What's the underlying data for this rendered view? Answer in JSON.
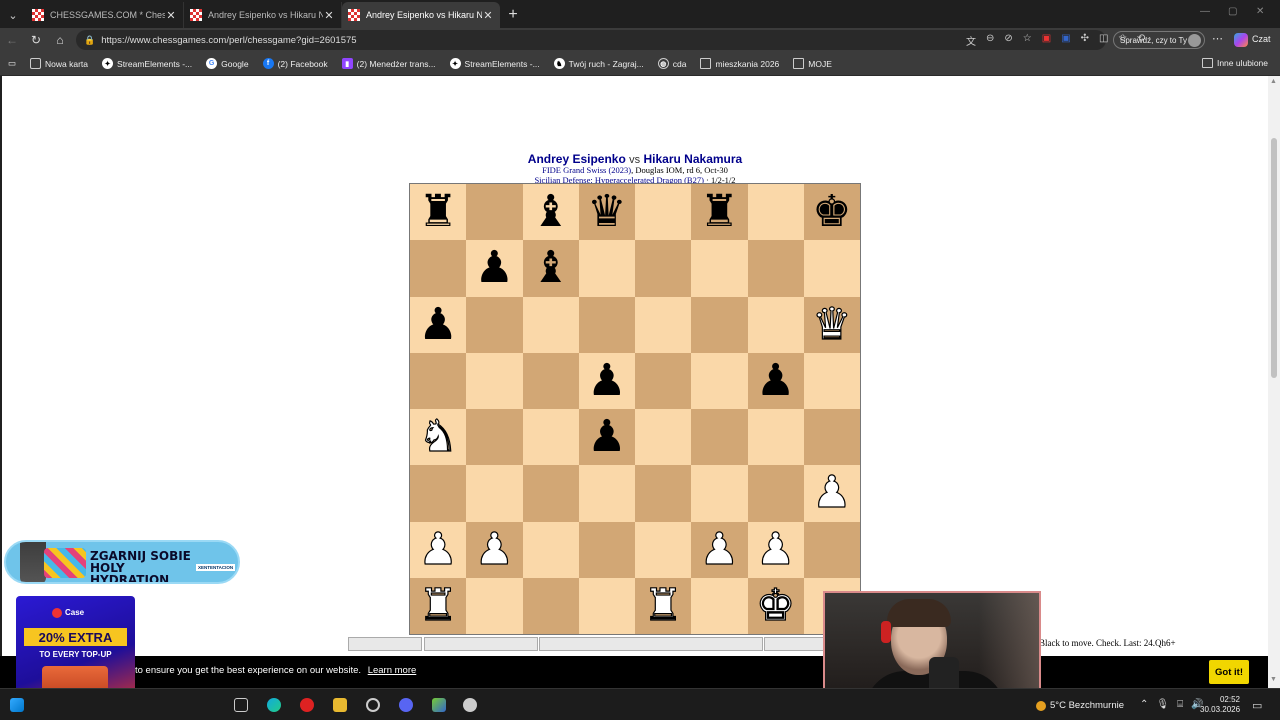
{
  "browser": {
    "tabs": [
      {
        "label": "CHESSGAMES.COM * Chess game",
        "active": false
      },
      {
        "label": "Andrey Esipenko vs Hikaru Nakam",
        "active": false
      },
      {
        "label": "Andrey Esipenko vs Hikaru Nakam",
        "active": true
      }
    ],
    "url": "https://www.chessgames.com/perl/chessgame?gid=2601575",
    "check_pill_label": "Sprawdź, czy to Ty",
    "copilot_label": "Czat",
    "bookmarks": [
      {
        "label": "Nowa karta",
        "icon": "page-icon"
      },
      {
        "label": "StreamElements -...",
        "icon": "streamelements-icon"
      },
      {
        "label": "Google",
        "icon": "google-icon"
      },
      {
        "label": "(2) Facebook",
        "icon": "facebook-icon"
      },
      {
        "label": "(2) Menedżer trans...",
        "icon": "twitch-icon"
      },
      {
        "label": "StreamElements -...",
        "icon": "streamelements-icon"
      },
      {
        "label": "Twój ruch - Zagraj...",
        "icon": "chess-icon"
      },
      {
        "label": "cda",
        "icon": "globe-icon"
      },
      {
        "label": "mieszkania 2026",
        "icon": "folder-icon"
      },
      {
        "label": "MOJE",
        "icon": "folder-icon"
      }
    ],
    "bookmarks_other": "Inne ulubione"
  },
  "game": {
    "white_player": "Andrey Esipenko",
    "vs": "vs",
    "black_player": "Hikaru Nakamura",
    "event_link": "FIDE Grand Swiss (2023)",
    "event_rest": ", Douglas IOM, rd 6, Oct-30",
    "opening_link": "Sicilian Defense: Hyperaccelerated Dragon (B27)",
    "opening_rest": " · 1/2-1/2",
    "status": "Black to move. Check. Last: 24.Qh6+",
    "board": [
      [
        "r",
        "",
        "b",
        "q",
        "",
        "r",
        "",
        "k"
      ],
      [
        "",
        "p",
        "b",
        "",
        "",
        "",
        "",
        ""
      ],
      [
        "p",
        "",
        "",
        "",
        "",
        "",
        "",
        "Q"
      ],
      [
        "",
        "",
        "",
        "p",
        "",
        "",
        "p",
        ""
      ],
      [
        "N",
        "",
        "",
        "p",
        "",
        "",
        "",
        ""
      ],
      [
        "",
        "",
        "",
        "",
        "",
        "",
        "",
        "P"
      ],
      [
        "P",
        "P",
        "",
        "",
        "",
        "P",
        "P",
        ""
      ],
      [
        "R",
        "",
        "",
        "",
        "R",
        "",
        "K",
        ""
      ]
    ],
    "light_square": "#fad8a9",
    "dark_square": "#d2a775"
  },
  "cookie": {
    "message": "to ensure you get the best experience on our website.",
    "learn_more": "Learn more",
    "button": "Got it!"
  },
  "ads": {
    "hydration_text": "ZGARNIJ SOBIE HOLY HYDRATION",
    "hydration_tag": "XENTENTACION",
    "case_logo": "Case",
    "case_big": "20% EXTRA",
    "case_sub": "TO EVERY TOP-UP"
  },
  "taskbar": {
    "weather": "5°C  Bezchmurnie",
    "time": "02:52",
    "date": "30.03.2026"
  }
}
